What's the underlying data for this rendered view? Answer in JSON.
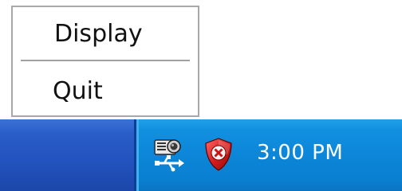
{
  "context_menu": {
    "items": [
      {
        "label": "Display"
      },
      {
        "label": "Quit"
      }
    ]
  },
  "taskbar": {
    "tray": {
      "icons": [
        {
          "name": "projector-usb-icon"
        },
        {
          "name": "security-shield-alert-icon",
          "status_color": "#d62020"
        }
      ],
      "clock": "3:00 PM"
    }
  },
  "colors": {
    "taskbar_blue": "#2458c2",
    "tray_blue": "#0c86d8",
    "menu_border": "#a8a8a8"
  }
}
